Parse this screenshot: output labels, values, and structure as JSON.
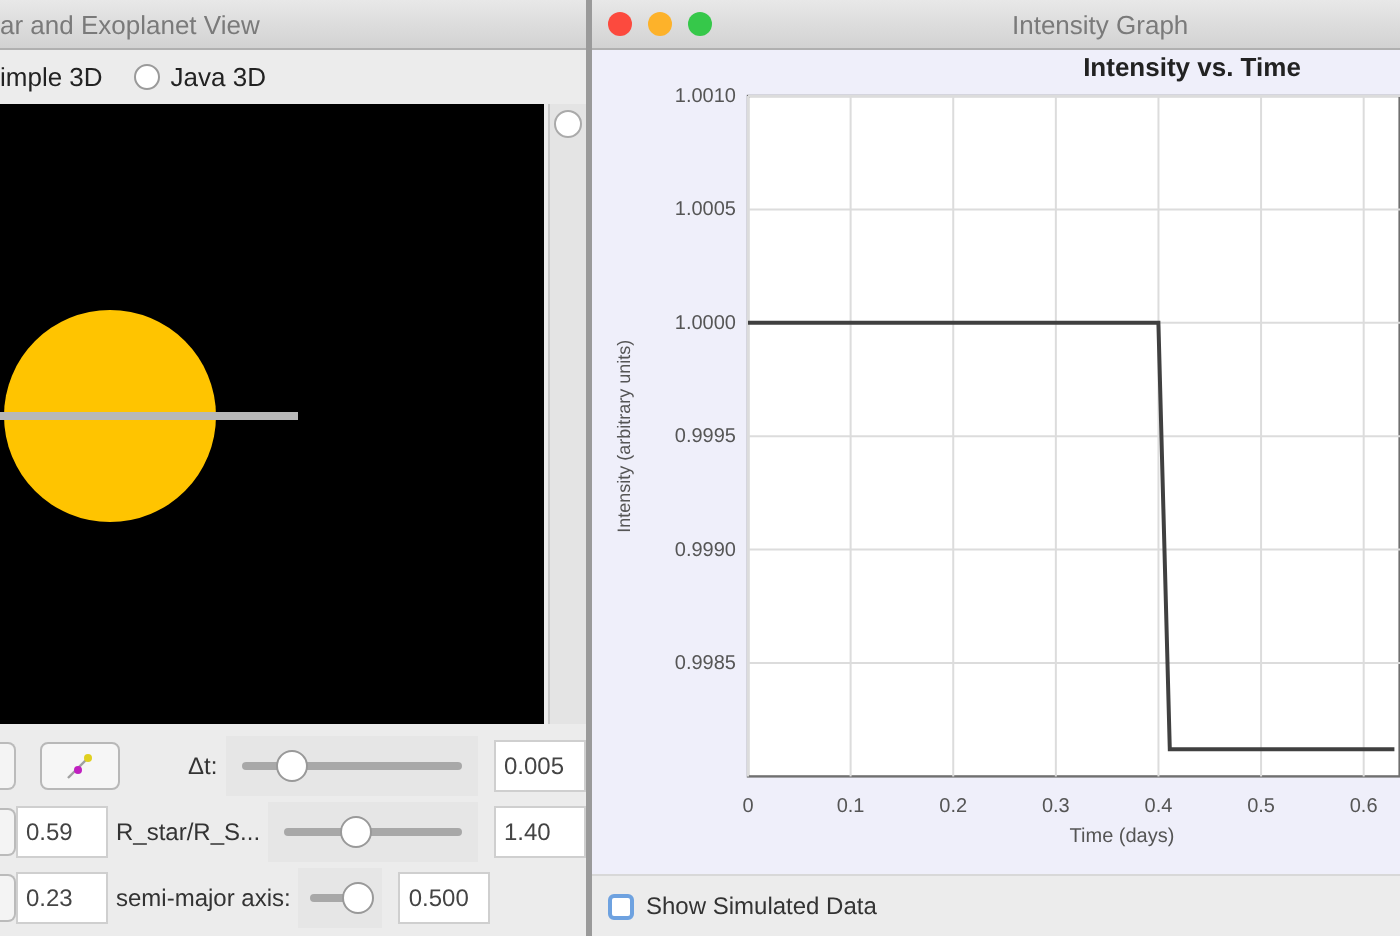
{
  "star_window": {
    "title": "ar and Exoplanet View",
    "view_options": [
      {
        "label": "imple 3D"
      },
      {
        "label": "Java 3D",
        "selected": false
      }
    ],
    "controls": [
      {
        "kind": "slider",
        "label": "Δt:",
        "level": 0.23,
        "value": "0.005"
      },
      {
        "kind": "slider",
        "left_value": "0.59",
        "label": "R_star/R_S...",
        "level": 0.4,
        "value": "1.40"
      },
      {
        "kind": "slider",
        "left_value": "0.23",
        "label": "semi-major axis:",
        "level": 0.8,
        "value": "0.500"
      }
    ]
  },
  "graph_window": {
    "title": "Intensity Graph",
    "chart_data": {
      "type": "line",
      "title": "Intensity vs. Time",
      "xlabel": "Time (days)",
      "ylabel": "Intensity (arbitrary units)",
      "xlim": [
        0,
        0.635
      ],
      "grid": true,
      "ylim": [
        0.998,
        1.001
      ],
      "xticks": [
        {
          "value": 0,
          "label": "0"
        },
        0.1,
        0.2,
        0.3,
        0.4,
        0.5,
        0.6
      ],
      "yticks": [
        {
          "value": 0.9985,
          "label": "0.9985"
        },
        {
          "value": 0.999,
          "label": "0.9990"
        },
        {
          "value": 0.9995,
          "label": "0.9995"
        },
        {
          "value": 1.0,
          "label": "1.0000"
        },
        {
          "value": 1.0005,
          "label": "1.0005"
        },
        {
          "value": 1.001,
          "label": "1.0010"
        }
      ],
      "x": [
        0,
        0.4,
        0.411,
        0.63
      ],
      "values": [
        1.0,
        1.0,
        0.99812,
        0.99812
      ]
    },
    "show_simulated_data": {
      "label": "Show Simulated Data",
      "checked": false
    }
  }
}
